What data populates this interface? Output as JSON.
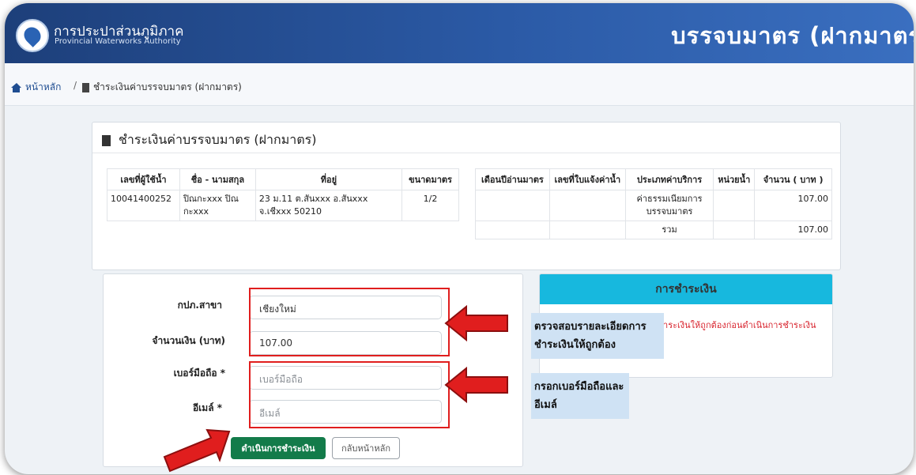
{
  "header": {
    "org_th": "การประปาส่วนภูมิภาค",
    "org_en": "Provincial Waterworks Authority",
    "heading": "บรรจบมาตร (ฝากมาตร"
  },
  "breadcrumb": {
    "home": "หน้าหลัก",
    "separator": "/",
    "current": "ชำระเงินค่าบรรจบมาตร (ฝากมาตร)"
  },
  "bill_card": {
    "title": "ชำระเงินค่าบรรจบมาตร (ฝากมาตร)",
    "left_table": {
      "headers": [
        "เลขที่ผู้ใช้น้ำ",
        "ชื่อ - นามสกุล",
        "ที่อยู่",
        "ขนาดมาตร"
      ],
      "row": {
        "account": "10041400252",
        "name": "ปิณกะxxx ปิณกะxxx",
        "address": "23 ม.11 ต.สันxxx อ.สันxxx จ.เชีxxx 50210",
        "meter_size": "1/2"
      }
    },
    "right_table": {
      "headers": [
        "เดือนปีอ่านมาตร",
        "เลขที่ใบแจ้งค่าน้ำ",
        "ประเภทค่าบริการ",
        "หน่วยน้ำ",
        "จำนวน ( บาท )"
      ],
      "row": {
        "read_month": "",
        "invoice_no": "",
        "service_type": "ค่าธรรมเนียมการบรรจบมาตร",
        "units": "",
        "amount": "107.00"
      },
      "total_label": "รวม",
      "total_amount": "107.00"
    }
  },
  "form": {
    "branch_label": "กปภ.สาขา",
    "branch_value": "เชียงใหม่",
    "amount_label": "จำนวนเงิน (บาท)",
    "amount_value": "107.00",
    "phone_label": "เบอร์มือถือ *",
    "phone_placeholder": "เบอร์มือถือ",
    "email_label": "อีเมล์ *",
    "email_placeholder": "อีเมล์",
    "pay_button": "ดำเนินการชำระเงิน",
    "back_button": "กลับหน้าหลัก"
  },
  "payment_card": {
    "title": "การชำระเงิน",
    "note": "ารชำระเงินให้ถูกต้องก่อนดำเนินการชำระเงิน"
  },
  "callouts": {
    "verify": "ตรวจสอบรายละเอียดการชำระเงินให้ถูกต้อง",
    "fill": "กรอกเบอร์มือถือและอีเมล์"
  },
  "colors": {
    "header_blue": "#2b5aa6",
    "pay_green": "#137b4a",
    "card_cyan": "#17b8de",
    "annotation_red": "#e01e1e",
    "callout_bg": "#cfe2f4"
  }
}
